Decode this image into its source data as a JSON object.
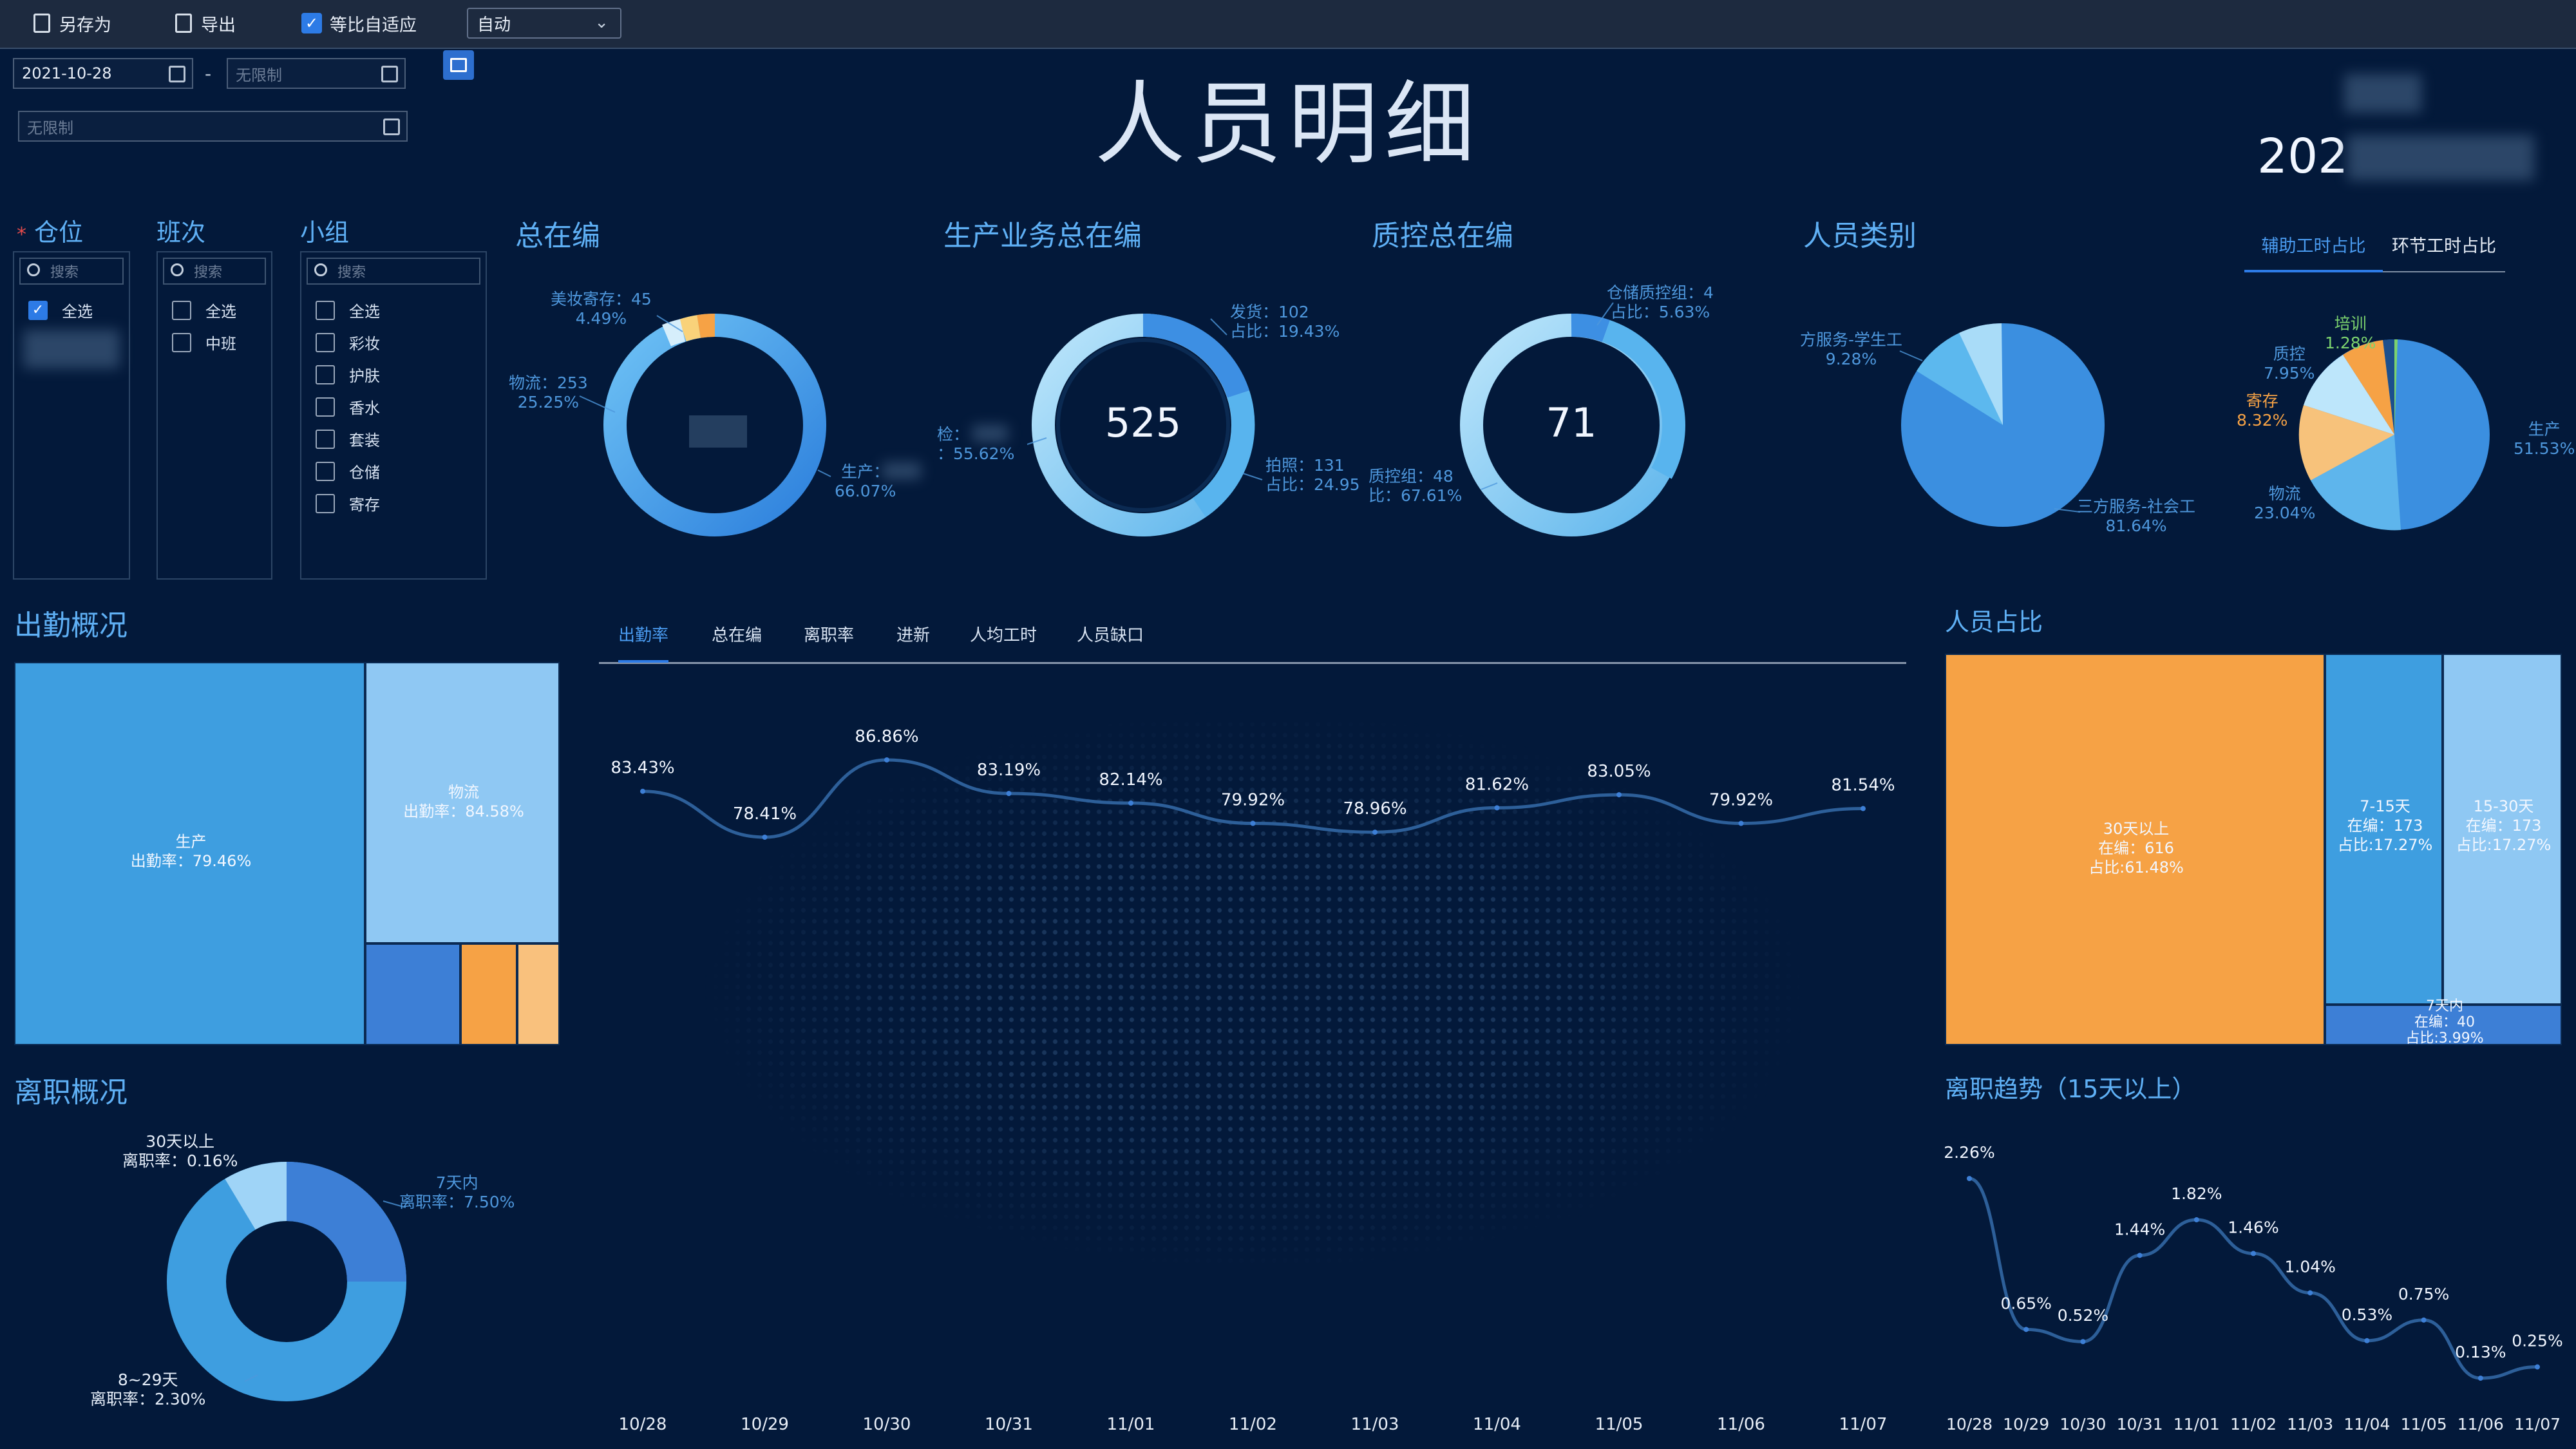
{
  "toolbar": {
    "save_as": "另存为",
    "export": "导出",
    "auto_fit": "等比自适应",
    "zoom_mode": "自动"
  },
  "filters": {
    "date_from": "2021-10-28",
    "date_separator": "-",
    "date_to_placeholder": "无限制",
    "extra_placeholder": "无限制",
    "warehouse_title": "仓位",
    "shift_title": "班次",
    "group_title": "小组",
    "search_placeholder": "搜索",
    "warehouse_options": [
      "全选"
    ],
    "shift_options": [
      "全选",
      "中班"
    ],
    "group_options": [
      "全选",
      "彩妆",
      "护肤",
      "香水",
      "套装",
      "仓储",
      "寄存"
    ]
  },
  "header": {
    "title": "人员明细",
    "date_partial": "202"
  },
  "kpi": {
    "total_title": "总在编",
    "production_title": "生产业务总在编",
    "production_value": "525",
    "qc_title": "质控总在编",
    "qc_value": "71",
    "category_title": "人员类别"
  },
  "donut_total": {
    "labels": [
      {
        "name": "美妆寄存：45",
        "pct": "4.49%"
      },
      {
        "name": "物流：253",
        "pct": "25.25%"
      },
      {
        "name": "生产：",
        "pct": "66.07%"
      }
    ]
  },
  "donut_production": {
    "labels": [
      {
        "name": "发货：102",
        "pct": "占比：19.43%"
      },
      {
        "name": "检：",
        "pct": "：55.62%"
      },
      {
        "name": "拍照：131",
        "pct": "占比：24.95"
      }
    ]
  },
  "donut_qc": {
    "labels": [
      {
        "name": "仓储质控组：4",
        "pct": "占比：5.63%"
      },
      {
        "name": "质控组：48",
        "pct": "比：67.61%"
      }
    ]
  },
  "category_pie": {
    "labels": [
      {
        "name": "方服务-学生工",
        "pct": "9.28%"
      },
      {
        "name": "三方服务-社会工",
        "pct": "81.64%"
      }
    ]
  },
  "ratio_tabs": [
    "辅助工时占比",
    "环节工时占比"
  ],
  "ratio_pie": {
    "labels": [
      {
        "name": "培训",
        "pct": "1.28%"
      },
      {
        "name": "质控",
        "pct": "7.95%"
      },
      {
        "name": "寄存",
        "pct": "8.32%"
      },
      {
        "name": "物流",
        "pct": "23.04%"
      },
      {
        "name": "生产",
        "pct": "51.53%"
      }
    ]
  },
  "attendance": {
    "title": "出勤概况",
    "production": {
      "name": "生产",
      "rate": "出勤率：79.46%"
    },
    "logistics": {
      "name": "物流",
      "rate": "出勤率：84.58%"
    }
  },
  "trend_tabs": [
    "出勤率",
    "总在编",
    "离职率",
    "进新",
    "人均工时",
    "人员缺口"
  ],
  "chart_data": [
    {
      "type": "line",
      "title": "",
      "x": [
        "10/28",
        "10/29",
        "10/30",
        "10/31",
        "11/01",
        "11/02",
        "11/03",
        "11/04",
        "11/05",
        "11/06",
        "11/07"
      ],
      "values": [
        83.43,
        78.41,
        86.86,
        83.19,
        82.14,
        79.92,
        78.96,
        81.62,
        83.05,
        79.92,
        81.54
      ],
      "value_labels": [
        "83.43%",
        "78.41%",
        "86.86%",
        "83.19%",
        "82.14%",
        "79.92%",
        "78.96%",
        "81.62%",
        "83.05%",
        "79.92%",
        "81.54%"
      ]
    },
    {
      "type": "line",
      "title": "离职趋势（15天以上）",
      "x": [
        "10/28",
        "10/29",
        "10/30",
        "10/31",
        "11/01",
        "11/02",
        "11/03",
        "11/04",
        "11/05",
        "11/06",
        "11/07"
      ],
      "values": [
        2.26,
        0.65,
        0.52,
        1.44,
        1.82,
        1.46,
        1.04,
        0.53,
        0.75,
        0.13,
        0.25
      ],
      "value_labels": [
        "2.26%",
        "0.65%",
        "0.52%",
        "1.44%",
        "1.82%",
        "1.46%",
        "1.04%",
        "0.53%",
        "0.75%",
        "0.13%",
        "0.25%"
      ]
    }
  ],
  "personnel_ratio": {
    "title": "人员占比",
    "cells": [
      {
        "name": "30天以上",
        "count": "在编：616",
        "pct": "占比:61.48%"
      },
      {
        "name": "7-15天",
        "count": "在编：173",
        "pct": "占比:17.27%"
      },
      {
        "name": "15-30天",
        "count": "在编：173",
        "pct": "占比:17.27%"
      },
      {
        "name": "7天内",
        "count": "在编：40",
        "pct": "占比:3.99%"
      }
    ]
  },
  "resignation": {
    "title": "离职概况",
    "labels": [
      {
        "name": "30天以上",
        "rate": "离职率：0.16%"
      },
      {
        "name": "7天内",
        "rate": "离职率：7.50%"
      },
      {
        "name": "8~29天",
        "rate": "离职率：2.30%"
      }
    ]
  },
  "colors": {
    "background": "#03193a",
    "accent_blue": "#4a9bf0",
    "orange": "#f6a245",
    "light_blue": "#8fc8f3",
    "mid_blue": "#3e9ee0"
  }
}
